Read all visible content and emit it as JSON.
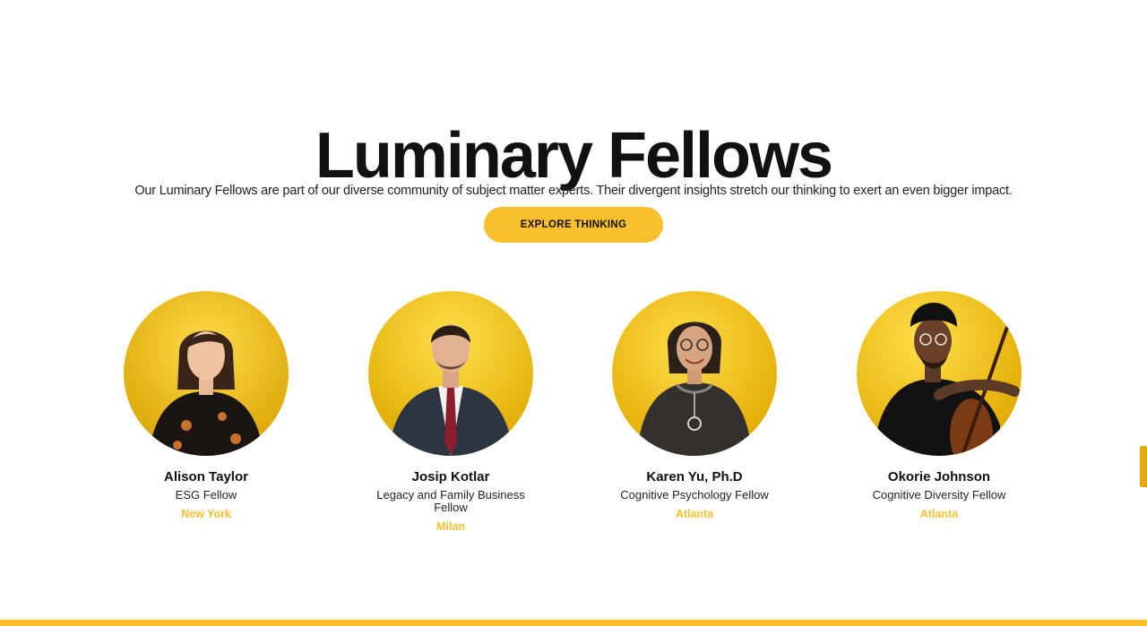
{
  "header": {
    "title": "Luminary Fellows",
    "subtitle": "Our Luminary Fellows are part of our diverse community of subject matter experts. Their divergent insights stretch our thinking to exert an even bigger impact.",
    "cta_label": "EXPLORE THINKING"
  },
  "fellows": [
    {
      "name": "Alison Taylor",
      "role": "ESG Fellow",
      "city": "New York"
    },
    {
      "name": "Josip Kotlar",
      "role": "Legacy and Family Business Fellow",
      "city": "Milan"
    },
    {
      "name": "Karen Yu, Ph.D",
      "role": "Cognitive Psychology Fellow",
      "city": "Atlanta"
    },
    {
      "name": "Okorie Johnson",
      "role": "Cognitive Diversity Fellow",
      "city": "Atlanta"
    }
  ],
  "colors": {
    "accent": "#f9bf2c",
    "text": "#111111",
    "background": "#ffffff"
  }
}
